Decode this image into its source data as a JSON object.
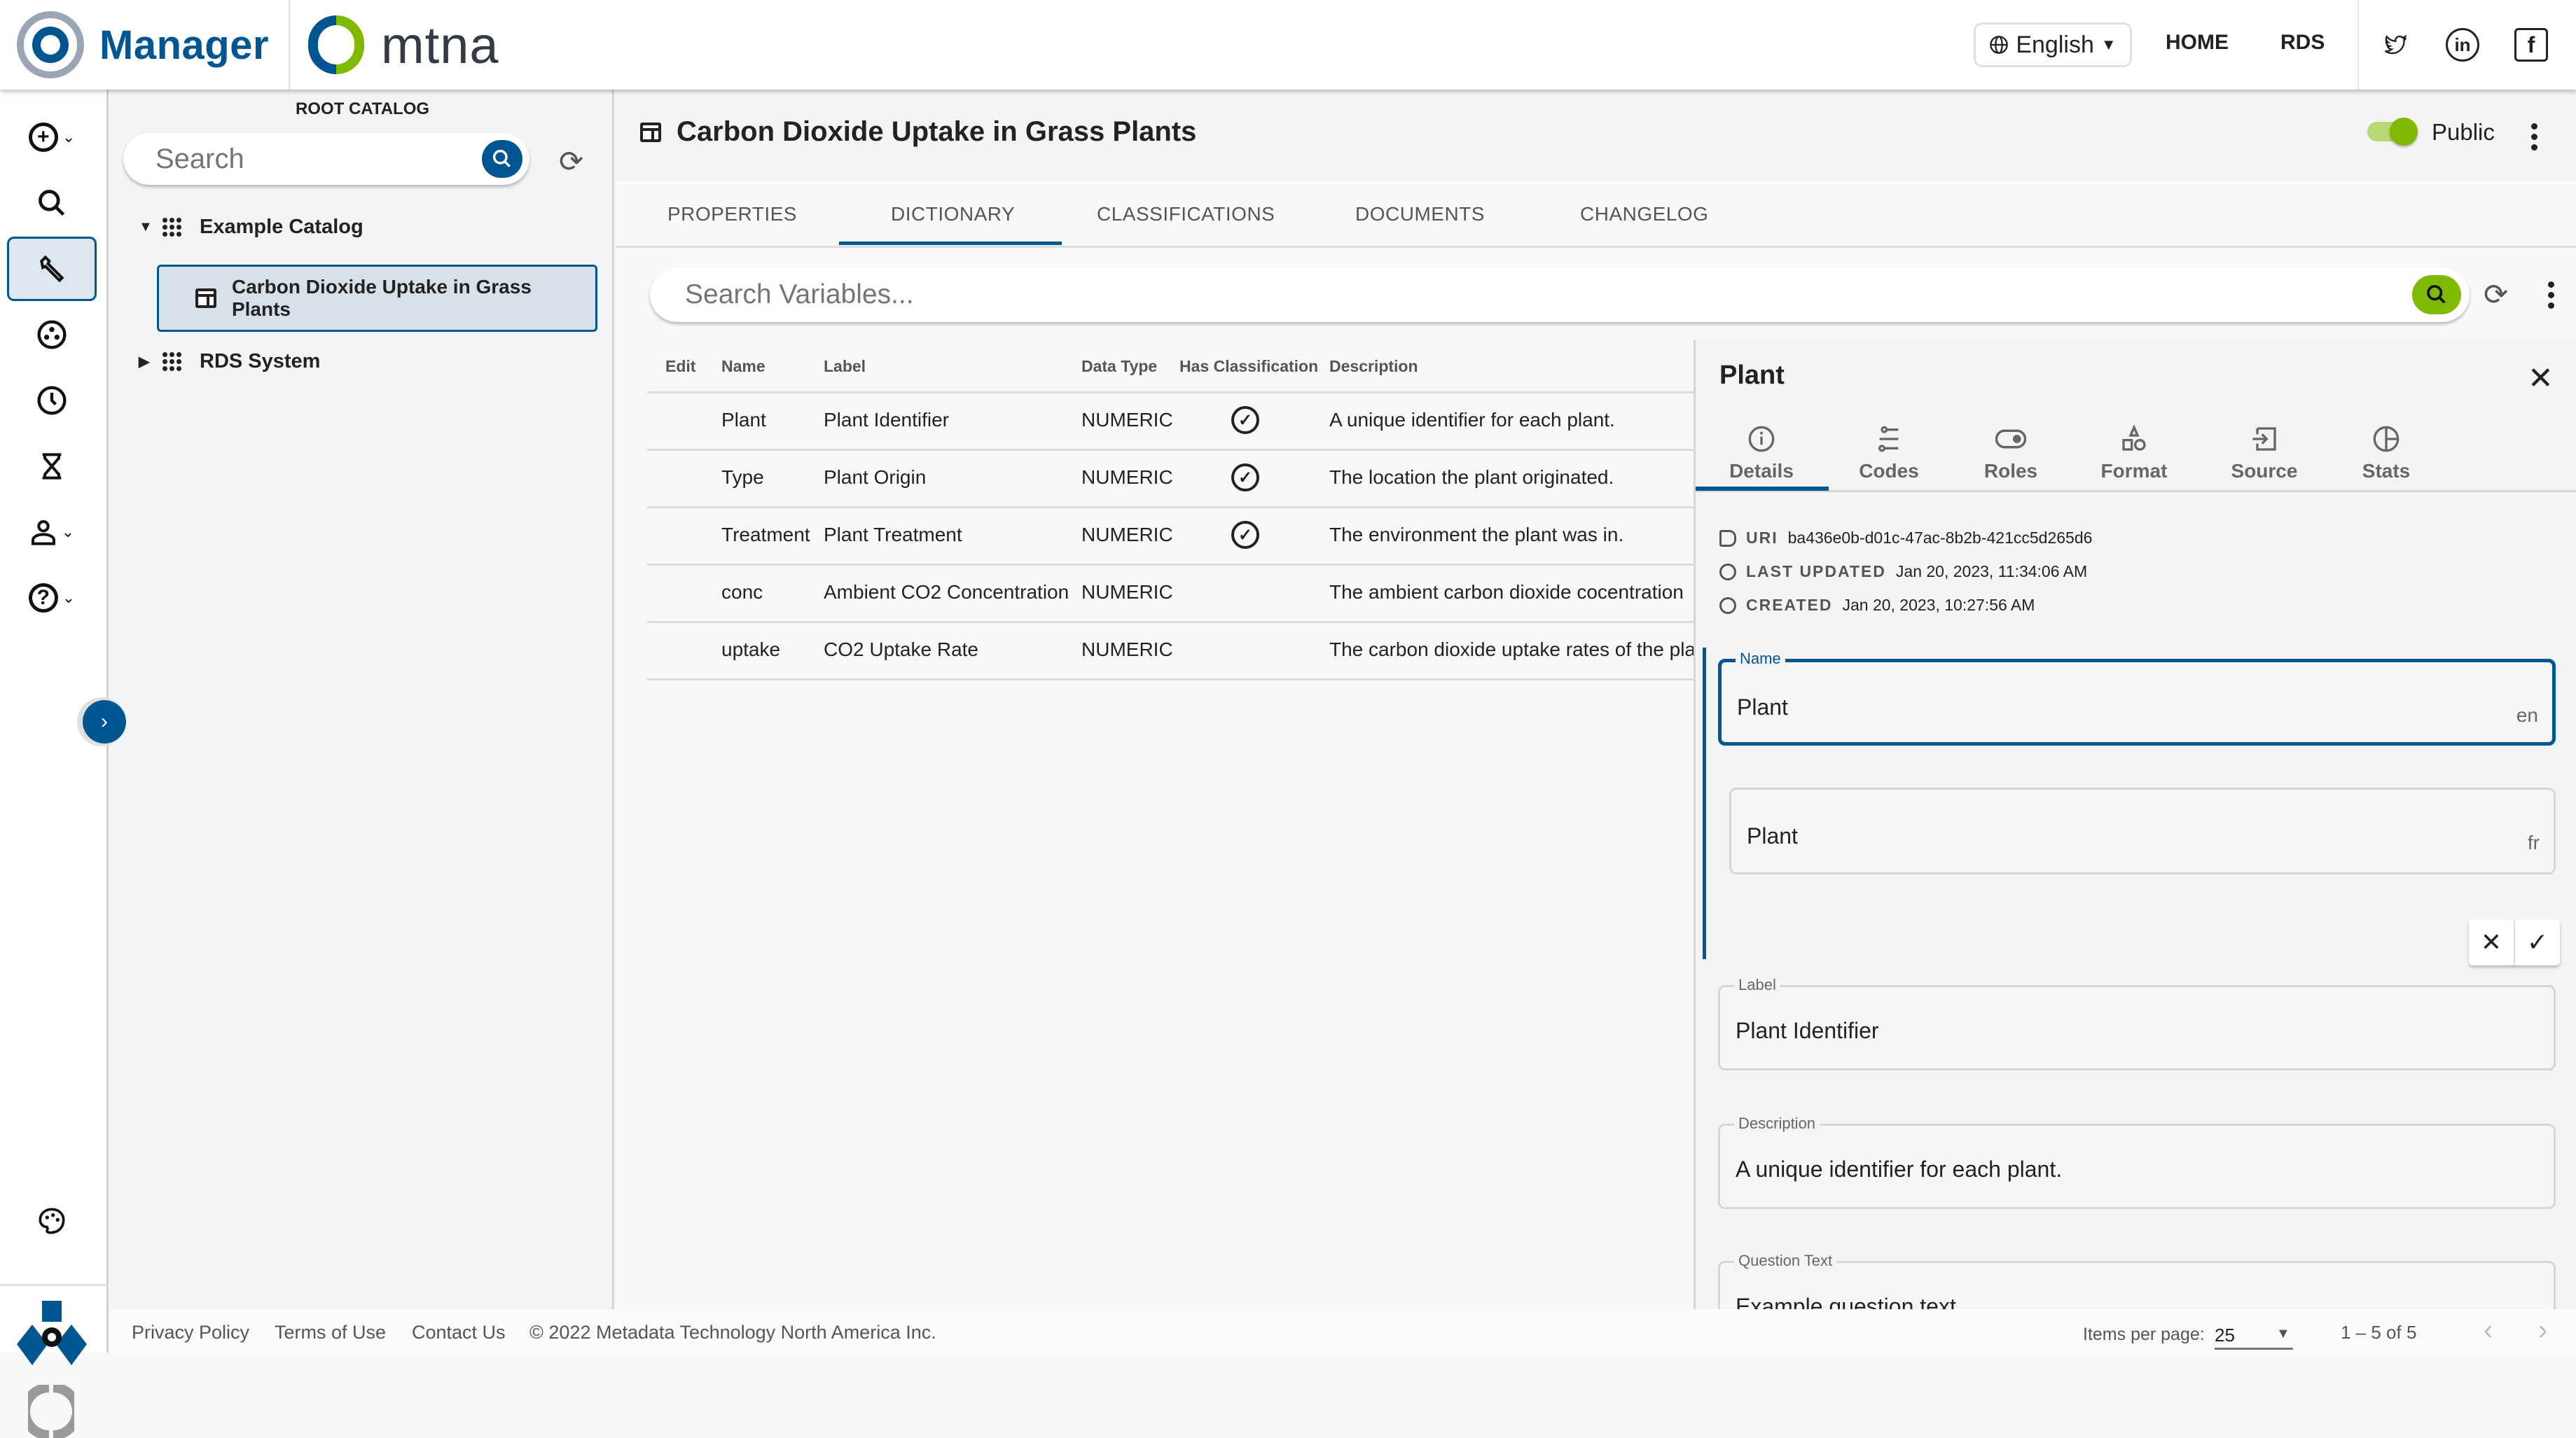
{
  "header": {
    "app_name": "Manager",
    "brand": "mtna",
    "language": "English",
    "nav": [
      "HOME",
      "RDS"
    ],
    "social": [
      "twitter",
      "linkedin",
      "facebook"
    ]
  },
  "rail": {
    "items": [
      {
        "name": "add",
        "icon": "plus-circle-icon",
        "has_menu": true
      },
      {
        "name": "search",
        "icon": "search-icon"
      },
      {
        "name": "manage",
        "icon": "wrench-icon",
        "active": true
      },
      {
        "name": "explore",
        "icon": "dots-circle-icon"
      },
      {
        "name": "history",
        "icon": "clock-icon"
      },
      {
        "name": "jobs",
        "icon": "hourglass-icon"
      },
      {
        "name": "user",
        "icon": "user-icon",
        "has_menu": true
      },
      {
        "name": "help",
        "icon": "help-icon",
        "has_menu": true
      }
    ],
    "bottom": [
      "palette-icon"
    ]
  },
  "tree": {
    "title": "ROOT CATALOG",
    "search_placeholder": "Search",
    "nodes": [
      {
        "label": "Example Catalog",
        "expanded": true
      },
      {
        "label": "Carbon Dioxide Uptake in Grass Plants",
        "selected": true
      },
      {
        "label": "RDS System",
        "expanded": false
      }
    ]
  },
  "main": {
    "title": "Carbon Dioxide Uptake in Grass Plants",
    "public_label": "Public",
    "public_on": true,
    "tabs": [
      "PROPERTIES",
      "DICTIONARY",
      "CLASSIFICATIONS",
      "DOCUMENTS",
      "CHANGELOG"
    ],
    "active_tab": "DICTIONARY",
    "search_placeholder": "Search Variables..."
  },
  "table": {
    "columns": [
      "Edit",
      "Name",
      "Label",
      "Data Type",
      "Has Classification",
      "Description"
    ],
    "rows": [
      {
        "name": "Plant",
        "label": "Plant Identifier",
        "type": "NUMERIC",
        "classified": true,
        "description": "A unique identifier for each plant."
      },
      {
        "name": "Type",
        "label": "Plant Origin",
        "type": "NUMERIC",
        "classified": true,
        "description": "The location the plant originated."
      },
      {
        "name": "Treatment",
        "label": "Plant Treatment",
        "type": "NUMERIC",
        "classified": true,
        "description": "The environment the plant was in."
      },
      {
        "name": "conc",
        "label": "Ambient CO2 Concentration",
        "type": "NUMERIC",
        "classified": false,
        "description": "The ambient carbon dioxide cocentration"
      },
      {
        "name": "uptake",
        "label": "CO2 Uptake Rate",
        "type": "NUMERIC",
        "classified": false,
        "description": "The carbon dioxide uptake rates of the pla"
      }
    ]
  },
  "detail": {
    "title": "Plant",
    "tabs": [
      "Details",
      "Codes",
      "Roles",
      "Format",
      "Source",
      "Stats"
    ],
    "active_tab": "Details",
    "uri_label": "URI",
    "uri": "ba436e0b-d01c-47ac-8b2b-421cc5d265d6",
    "updated_label": "LAST UPDATED",
    "updated": "Jan 20, 2023, 11:34:06 AM",
    "created_label": "CREATED",
    "created": "Jan 20, 2023, 10:27:56 AM",
    "name_label": "Name",
    "name_en": "Plant",
    "lang_en": "en",
    "name_fr": "Plant",
    "lang_fr": "fr",
    "label_label": "Label",
    "label_value": "Plant Identifier",
    "description_label": "Description",
    "description_value": "A unique identifier for each plant.",
    "question_label": "Question Text",
    "question_value": "Example question text"
  },
  "footer": {
    "links": [
      "Privacy Policy",
      "Terms of Use",
      "Contact Us"
    ],
    "copyright": "© 2022 Metadata Technology North America Inc.",
    "items_per_page_label": "Items per page:",
    "items_per_page": "25",
    "range": "1 – 5 of 5"
  },
  "colors": {
    "primary": "#005691",
    "accent": "#7fba00"
  }
}
